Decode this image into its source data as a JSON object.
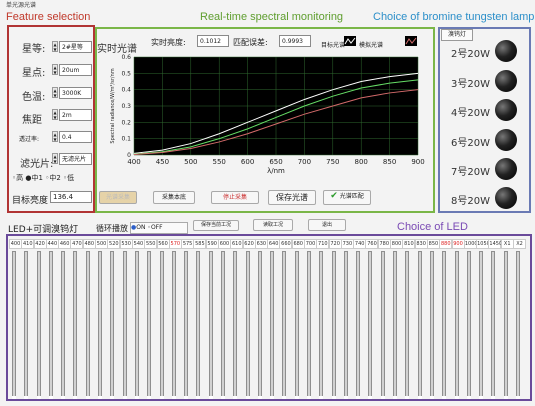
{
  "window": {
    "title": "单光源光谱"
  },
  "regions": {
    "feature": "Feature selection",
    "spectral": "Real-time spectral monitoring",
    "bromine": "Choice of bromine tungsten lamp",
    "led": "Choice of LED"
  },
  "feature": {
    "fields": [
      {
        "label": "星等:",
        "value": "2#星等"
      },
      {
        "label": "星点:",
        "value": "20um"
      },
      {
        "label": "色温:",
        "value": "3000K"
      },
      {
        "label": "焦距",
        "value": "2m"
      },
      {
        "label": "透过率:",
        "value": "0.4"
      },
      {
        "label": "滤光片:",
        "value": "无滤光片"
      }
    ],
    "radios": [
      "高",
      "中1",
      "中2",
      "低"
    ],
    "target_label": "目标亮度",
    "target_value": "136.4"
  },
  "spectral": {
    "title": "实时光谱",
    "brightness_label": "实时亮度:",
    "brightness_value": "0.1012",
    "error_label": "匹配误差:",
    "error_value": "0.9993",
    "legend": [
      "目标光谱",
      "模拟光谱"
    ],
    "buttons": [
      "光谱采集",
      "采集本底",
      "停止采集",
      "保存光谱",
      "光谱匹配"
    ]
  },
  "chart_data": {
    "type": "line",
    "xlabel": "λ/nm",
    "ylabel": "Spectral radiance/W/m²/sr/nm",
    "xlim": [
      400,
      900
    ],
    "ylim": [
      0,
      0.6
    ],
    "x_ticks": [
      "400",
      "450",
      "500",
      "550",
      "600",
      "650",
      "700",
      "750",
      "800",
      "850",
      "900"
    ],
    "y_ticks": [
      "0",
      "0.1",
      "0.2",
      "0.3",
      "0.4",
      "0.5",
      "0.6"
    ],
    "grid": true,
    "background": "#000000",
    "series": [
      {
        "color": "#ffffff",
        "x": [
          400,
          450,
          500,
          550,
          600,
          650,
          700,
          750,
          800,
          850,
          900
        ],
        "y": [
          0.01,
          0.03,
          0.07,
          0.13,
          0.2,
          0.27,
          0.34,
          0.4,
          0.45,
          0.48,
          0.5
        ]
      },
      {
        "color": "#66dd66",
        "x": [
          400,
          450,
          500,
          550,
          600,
          650,
          700,
          750,
          800,
          850,
          900
        ],
        "y": [
          0.005,
          0.02,
          0.05,
          0.1,
          0.16,
          0.23,
          0.3,
          0.36,
          0.41,
          0.44,
          0.46
        ]
      },
      {
        "color": "#d36a6a",
        "x": [
          400,
          450,
          500,
          550,
          600,
          650,
          700,
          750,
          800,
          850,
          900
        ],
        "y": [
          0.003,
          0.015,
          0.04,
          0.08,
          0.13,
          0.19,
          0.25,
          0.3,
          0.35,
          0.38,
          0.4
        ]
      }
    ]
  },
  "lamps": {
    "title": "溴钨灯",
    "items": [
      "2号20W",
      "3号20W",
      "4号20W",
      "6号20W",
      "7号20W",
      "8号20W"
    ]
  },
  "led": {
    "panel_label": "LED+可调溴钨灯",
    "loop_label": "循环播放",
    "on_label": "ON",
    "off_label": "OFF",
    "buttons": [
      "保存当前工况",
      "读取工况",
      "退出"
    ],
    "channels": [
      "400",
      "410",
      "420",
      "440",
      "460",
      "470",
      "480",
      "500",
      "520",
      "530",
      "540",
      "550",
      "560",
      "570",
      "575",
      "585",
      "590",
      "600",
      "610",
      "620",
      "630",
      "640",
      "660",
      "680",
      "700",
      "710",
      "720",
      "730",
      "740",
      "760",
      "780",
      "800",
      "810",
      "830",
      "850",
      "880",
      "900",
      "1000",
      "1050",
      "1450",
      "X1",
      "X2"
    ],
    "highlight_channels": [
      "570",
      "880",
      "900"
    ],
    "highlight_color": "#dd2222"
  },
  "colors": {
    "feature": "#b13434",
    "spectral": "#7ab648",
    "bromine": "#2c8fc9",
    "led": "#6a4a9a"
  }
}
